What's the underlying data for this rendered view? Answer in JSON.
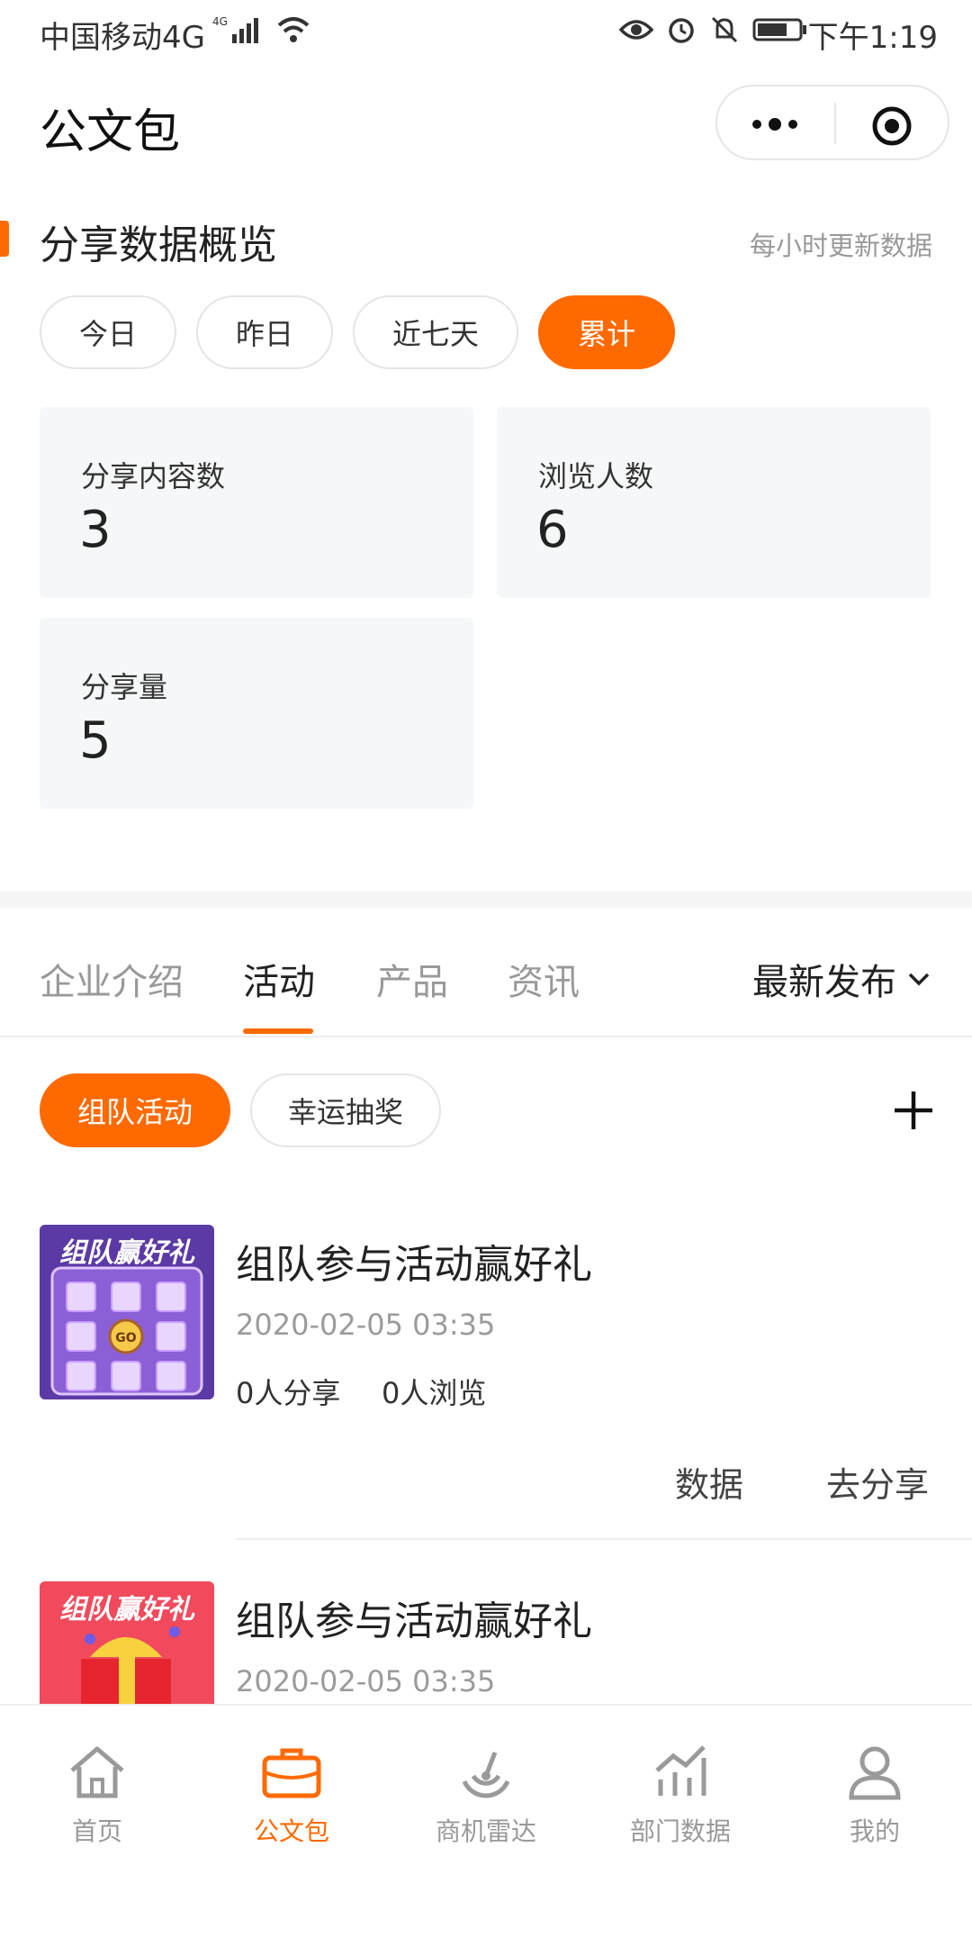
{
  "status_bar": {
    "carrier": "中国移动4G",
    "time": "下午1:19"
  },
  "header": {
    "title": "公文包"
  },
  "overview": {
    "title": "分享数据概览",
    "update_note": "每小时更新数据",
    "periods": [
      "今日",
      "昨日",
      "近七天",
      "累计"
    ],
    "selected_period": "累计",
    "stats": [
      {
        "label": "分享内容数",
        "value": "3"
      },
      {
        "label": "浏览人数",
        "value": "6"
      },
      {
        "label": "分享量",
        "value": "5"
      }
    ]
  },
  "content_tabs": {
    "tabs": [
      "企业介绍",
      "活动",
      "产品",
      "资讯"
    ],
    "active": "活动",
    "sort_label": "最新发布"
  },
  "activity_types": {
    "items": [
      "组队活动",
      "幸运抽奖"
    ],
    "active": "组队活动"
  },
  "items": [
    {
      "thumb_text": "组队赢好礼",
      "title": "组队参与活动赢好礼",
      "date": "2020-02-05 03:35",
      "shares": "0人分享",
      "views": "0人浏览",
      "action_data": "数据",
      "action_share": "去分享"
    },
    {
      "thumb_text": "组队赢好礼",
      "title": "组队参与活动赢好礼",
      "date": "2020-02-05 03:35"
    }
  ],
  "bottom_nav": {
    "items": [
      {
        "label": "首页",
        "icon": "home-icon"
      },
      {
        "label": "公文包",
        "icon": "briefcase-icon"
      },
      {
        "label": "商机雷达",
        "icon": "radar-icon"
      },
      {
        "label": "部门数据",
        "icon": "chart-icon"
      },
      {
        "label": "我的",
        "icon": "user-icon"
      }
    ],
    "active": "公文包"
  },
  "colors": {
    "accent": "#ff6a00",
    "card_bg": "#f6f7f9",
    "muted_text": "#999999"
  }
}
